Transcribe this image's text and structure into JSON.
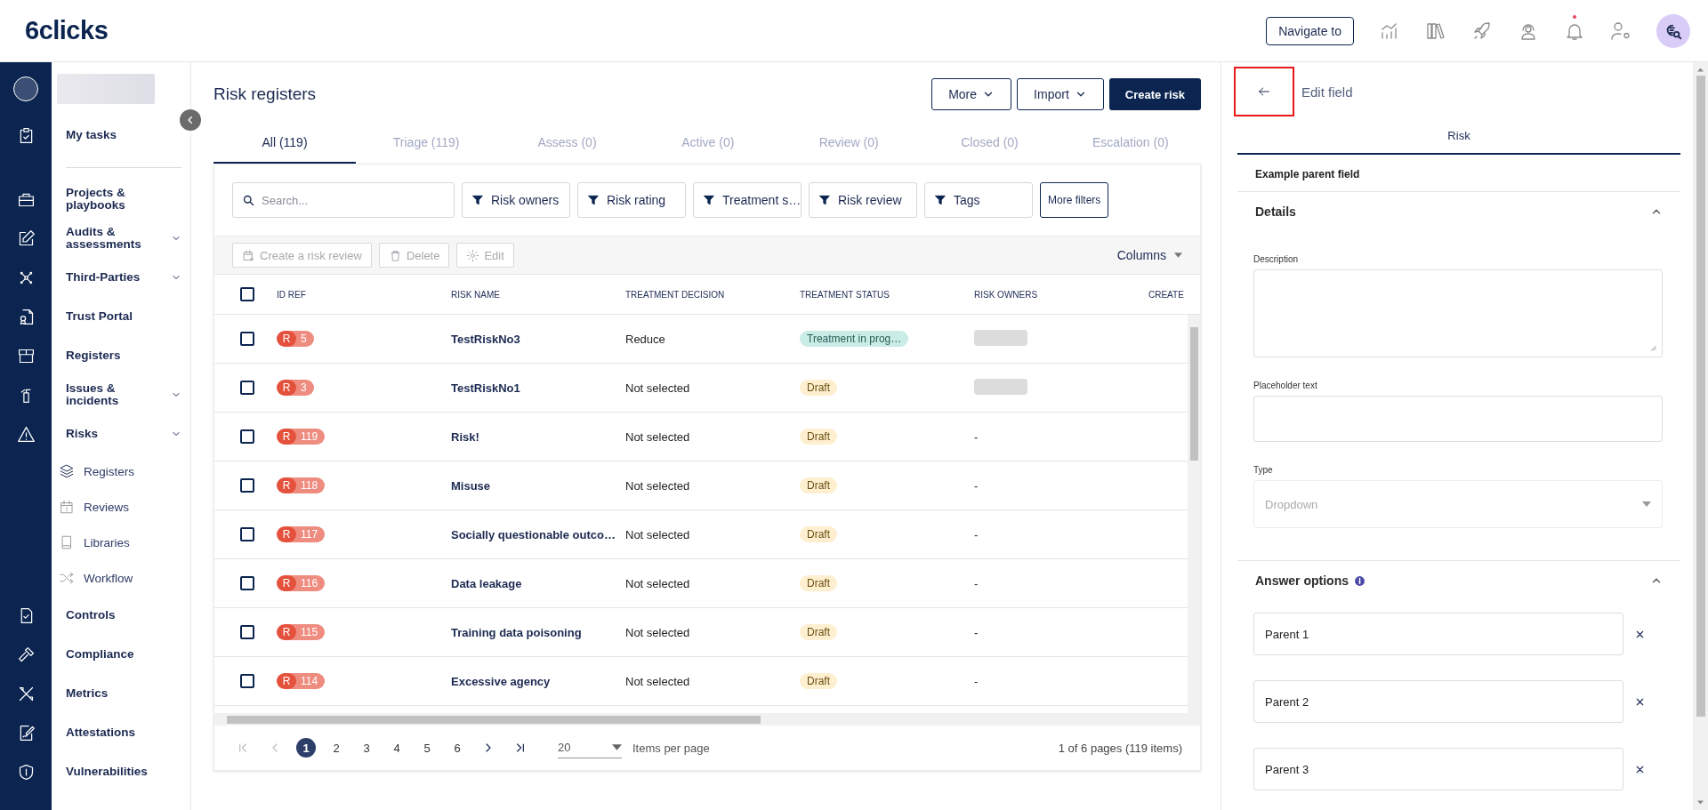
{
  "header": {
    "logo": "6clicks",
    "navigate_button": "Navigate to",
    "bell_unread": true
  },
  "sidebar": {
    "pinned": [
      {
        "label": "My tasks"
      }
    ],
    "items": [
      {
        "label": "Projects & playbooks"
      },
      {
        "label": "Audits & assessments",
        "kind": "group"
      },
      {
        "label": "Third-Parties",
        "kind": "group"
      },
      {
        "label": "Trust Portal"
      },
      {
        "label": "Registers"
      },
      {
        "label": "Issues & incidents",
        "kind": "group"
      },
      {
        "label": "Risks",
        "kind": "group",
        "expanded": true,
        "children": [
          {
            "label": "Registers"
          },
          {
            "label": "Reviews"
          },
          {
            "label": "Libraries"
          },
          {
            "label": "Workflow"
          }
        ]
      },
      {
        "label": "Controls"
      },
      {
        "label": "Compliance"
      },
      {
        "label": "Metrics"
      },
      {
        "label": "Attestations"
      },
      {
        "label": "Vulnerabilities"
      }
    ]
  },
  "main": {
    "title": "Risk registers",
    "buttons": [
      {
        "label": "More",
        "kind": "menu"
      },
      {
        "label": "Import",
        "kind": "menu"
      },
      {
        "label": "Create risk",
        "kind": "primary"
      }
    ],
    "tabs": [
      {
        "label": "All (119)",
        "selected": true
      },
      {
        "label": "Triage (119)",
        "selected": false
      },
      {
        "label": "Assess (0)",
        "selected": false
      },
      {
        "label": "Active (0)",
        "selected": false
      },
      {
        "label": "Review (0)",
        "selected": false
      },
      {
        "label": "Closed (0)",
        "selected": false
      },
      {
        "label": "Escalation (0)",
        "selected": false
      }
    ],
    "search": {
      "placeholder": "Search..."
    },
    "filters": [
      "Risk owners",
      "Risk rating",
      "Treatment s…",
      "Risk review",
      "Tags"
    ],
    "more_filters": "More filters",
    "actions": [
      {
        "label": "Create a risk review",
        "kind": "review",
        "disabled": true
      },
      {
        "label": "Delete",
        "kind": "delete",
        "disabled": true
      },
      {
        "label": "Edit",
        "kind": "edit",
        "disabled": true
      }
    ],
    "columns_button": "Columns",
    "table": {
      "all_checked": false,
      "columns": [
        "ID REF",
        "RISK NAME",
        "TREATMENT DECISION",
        "TREATMENT STATUS",
        "RISK OWNERS",
        "CREATE"
      ],
      "rows": [
        {
          "checked": false,
          "id_prefix": "R",
          "id": "5",
          "name": "TestRiskNo3",
          "decision": "Reduce",
          "status": {
            "kind": "in_progress",
            "label": "Treatment in prog…"
          },
          "owners": {
            "kind": "redacted"
          }
        },
        {
          "checked": false,
          "id_prefix": "R",
          "id": "3",
          "name": "TestRiskNo1",
          "decision": "Not selected",
          "status": {
            "kind": "draft",
            "label": "Draft"
          },
          "owners": {
            "kind": "redacted"
          }
        },
        {
          "checked": false,
          "id_prefix": "R",
          "id": "119",
          "name": "Risk!",
          "decision": "Not selected",
          "status": {
            "kind": "draft",
            "label": "Draft"
          },
          "owners": {
            "kind": "text",
            "text": "-"
          }
        },
        {
          "checked": false,
          "id_prefix": "R",
          "id": "118",
          "name": "Misuse",
          "decision": "Not selected",
          "status": {
            "kind": "draft",
            "label": "Draft"
          },
          "owners": {
            "kind": "text",
            "text": "-"
          }
        },
        {
          "checked": false,
          "id_prefix": "R",
          "id": "117",
          "name": "Socially questionable outco…",
          "decision": "Not selected",
          "status": {
            "kind": "draft",
            "label": "Draft"
          },
          "owners": {
            "kind": "text",
            "text": "-"
          }
        },
        {
          "checked": false,
          "id_prefix": "R",
          "id": "116",
          "name": "Data leakage",
          "decision": "Not selected",
          "status": {
            "kind": "draft",
            "label": "Draft"
          },
          "owners": {
            "kind": "text",
            "text": "-"
          }
        },
        {
          "checked": false,
          "id_prefix": "R",
          "id": "115",
          "name": "Training data poisoning",
          "decision": "Not selected",
          "status": {
            "kind": "draft",
            "label": "Draft"
          },
          "owners": {
            "kind": "text",
            "text": "-"
          }
        },
        {
          "checked": false,
          "id_prefix": "R",
          "id": "114",
          "name": "Excessive agency",
          "decision": "Not selected",
          "status": {
            "kind": "draft",
            "label": "Draft"
          },
          "owners": {
            "kind": "text",
            "text": "-"
          }
        }
      ]
    },
    "pagination": {
      "nav": [
        {
          "kind": "first",
          "disabled": true
        },
        {
          "kind": "prev",
          "disabled": true
        },
        {
          "kind": "next",
          "disabled": false
        },
        {
          "kind": "last",
          "disabled": false
        }
      ],
      "pages": [
        {
          "label": "1",
          "selected": true
        },
        {
          "label": "2",
          "selected": false
        },
        {
          "label": "3",
          "selected": false
        },
        {
          "label": "4",
          "selected": false
        },
        {
          "label": "5",
          "selected": false
        },
        {
          "label": "6",
          "selected": false
        }
      ],
      "per_page": "20",
      "per_page_label": "Items per page",
      "summary": "1 of 6 pages (119 items)"
    }
  },
  "panel": {
    "back_highlighted": true,
    "title": "Edit field",
    "tabs": [
      {
        "label": "Risk",
        "selected": true
      }
    ],
    "field_name": "Example parent field",
    "sections": [
      {
        "kind": "details",
        "title": "Details",
        "expanded": true,
        "fields": [
          {
            "kind": "textarea",
            "label": "Description"
          },
          {
            "kind": "input",
            "label": "Placeholder text"
          },
          {
            "kind": "select",
            "label": "Type",
            "value": "Dropdown",
            "disabled": true
          }
        ]
      },
      {
        "kind": "options",
        "title": "Answer options",
        "info": true,
        "expanded": true,
        "options": [
          {
            "value": "Parent 1"
          },
          {
            "value": "Parent 2"
          },
          {
            "value": "Parent 3"
          }
        ]
      }
    ]
  }
}
